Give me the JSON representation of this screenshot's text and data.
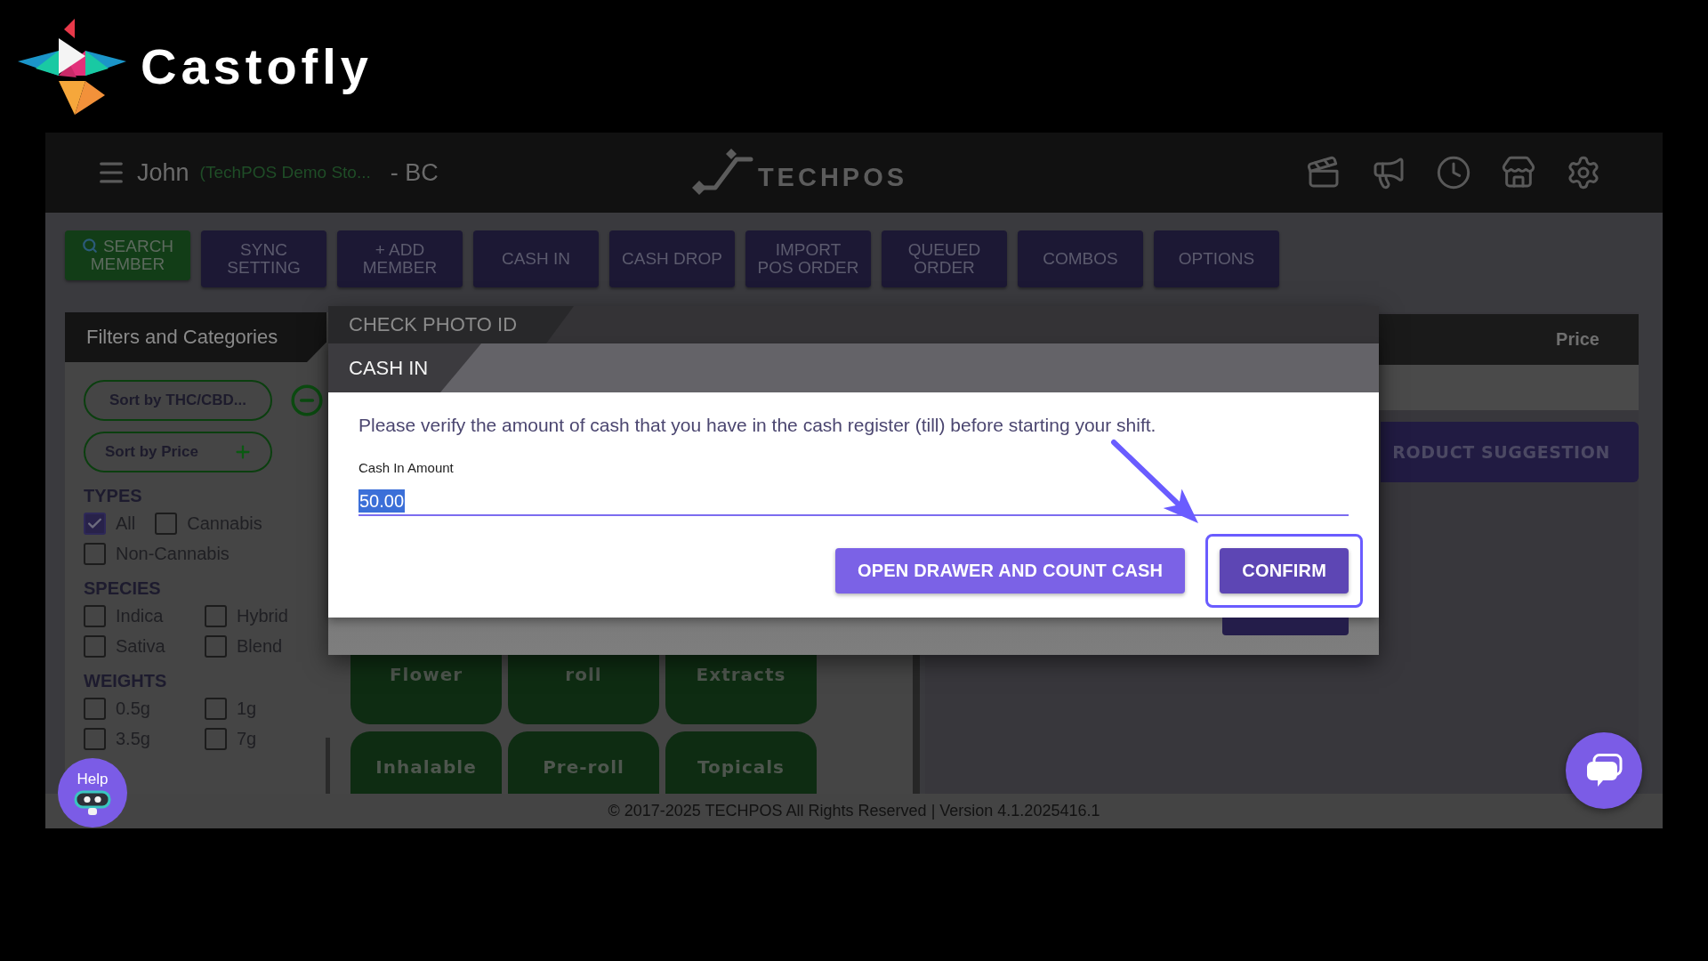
{
  "brand": {
    "name": "Castofly"
  },
  "header": {
    "user": "John",
    "store": "(TechPOS Demo Sto...",
    "region": "- BC",
    "logo_text": "TECHPOS"
  },
  "toolbar": [
    {
      "label": "SEARCH MEMBER",
      "kind": "search"
    },
    {
      "label": "SYNC SETTING",
      "kind": "action"
    },
    {
      "label": "+ ADD MEMBER",
      "kind": "action"
    },
    {
      "label": "CASH IN",
      "kind": "action"
    },
    {
      "label": "CASH DROP",
      "kind": "action"
    },
    {
      "label": "IMPORT POS ORDER",
      "kind": "action"
    },
    {
      "label": "QUEUED ORDER",
      "kind": "action"
    },
    {
      "label": "COMBOS",
      "kind": "action"
    },
    {
      "label": "OPTIONS",
      "kind": "action"
    }
  ],
  "filters": {
    "title": "Filters and Categories",
    "sorts": [
      {
        "label": "Sort by THC/CBD...",
        "selected": true
      },
      {
        "label": "Sort by Price",
        "selected": false
      }
    ],
    "groups": [
      {
        "heading": "TYPES",
        "kind": "inline",
        "options": [
          {
            "label": "All",
            "checked": true
          },
          {
            "label": "Cannabis",
            "checked": false
          },
          {
            "label": "Non-Cannabis",
            "checked": false
          }
        ]
      },
      {
        "heading": "SPECIES",
        "kind": "columns",
        "options": [
          {
            "label": "Indica",
            "checked": false
          },
          {
            "label": "Hybrid",
            "checked": false
          },
          {
            "label": "Sativa",
            "checked": false
          },
          {
            "label": "Blend",
            "checked": false
          }
        ]
      },
      {
        "heading": "WEIGHTS",
        "kind": "columns",
        "options": [
          {
            "label": "0.5g",
            "checked": false
          },
          {
            "label": "1g",
            "checked": false
          },
          {
            "label": "3.5g",
            "checked": false
          },
          {
            "label": "7g",
            "checked": false
          }
        ]
      }
    ]
  },
  "dialogs": {
    "back": {
      "title": "CHECK PHOTO ID"
    },
    "front": {
      "title": "CASH IN",
      "message": "Please verify the amount of cash that you have in the cash register (till) before starting your shift.",
      "field": {
        "label": "Cash In Amount",
        "value": "50.00",
        "text_selected": true
      },
      "buttons": [
        {
          "label": "OPEN DRAWER AND COUNT CASH",
          "kind": "secondary",
          "highlighted": false
        },
        {
          "label": "CONFIRM",
          "kind": "primary",
          "highlighted": true
        }
      ]
    }
  },
  "categories": [
    {
      "label": "Flower"
    },
    {
      "label": "roll"
    },
    {
      "label": "Extracts"
    },
    {
      "label": "Inhalable"
    },
    {
      "label": "Pre-roll"
    },
    {
      "label": "Topicals"
    }
  ],
  "cart": {
    "columns": [
      "Price"
    ],
    "suggestion_button": "RODUCT SUGGESTION"
  },
  "help_button": {
    "label": "Help"
  },
  "footer": "© 2017-2025 TECHPOS All Rights Reserved | Version 4.1.2025416.1"
}
